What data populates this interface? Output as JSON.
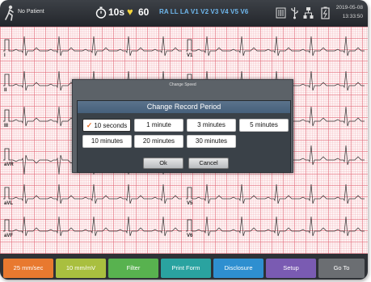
{
  "topbar": {
    "patient": "No Patient",
    "record_time": "10s",
    "heart_rate": "60",
    "leads": "RA LL LA V1 V2 V3 V4 V5 V6",
    "date": "2019-05-08",
    "time": "13:33:50"
  },
  "leads": [
    "I",
    "II",
    "III",
    "aVR",
    "aVL",
    "aVF",
    "V1",
    "V2",
    "V3",
    "V4",
    "V5",
    "V6"
  ],
  "dialog": {
    "outer_title": "Change Speed",
    "title": "Change Record Period",
    "options": [
      "10 seconds",
      "1 minute",
      "3 minutes",
      "5 minutes",
      "10 minutes",
      "20 minutes",
      "30 minutes"
    ],
    "selected_index": 0,
    "ok": "Ok",
    "cancel": "Cancel"
  },
  "bottombar": {
    "buttons": [
      {
        "label": "25 mm/sec",
        "color": "#e8792f"
      },
      {
        "label": "10 mm/mV",
        "color": "#a9bf3f"
      },
      {
        "label": "Filter",
        "color": "#58b24f"
      },
      {
        "label": "Print Form",
        "color": "#2aa3a0"
      },
      {
        "label": "Disclosure",
        "color": "#2e8fd0"
      },
      {
        "label": "Setup",
        "color": "#7a5bb2"
      },
      {
        "label": "Go To",
        "color": "#6b6e72"
      }
    ]
  }
}
